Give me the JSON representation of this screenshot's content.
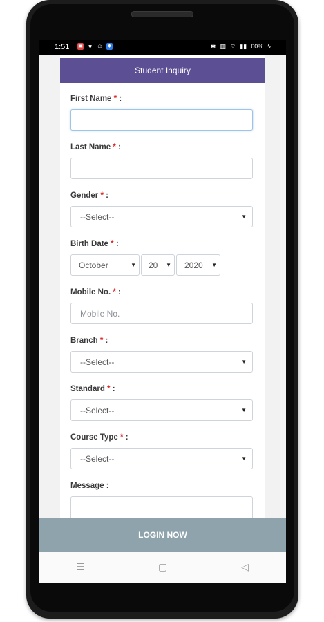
{
  "status_bar": {
    "time": "1:51",
    "battery": "60%"
  },
  "header": {
    "title": "Student Inquiry"
  },
  "form": {
    "first_name": {
      "label": "First Name",
      "required_mark": "*",
      "colon": ":",
      "value": ""
    },
    "last_name": {
      "label": "Last Name",
      "required_mark": "*",
      "colon": ":",
      "value": ""
    },
    "gender": {
      "label": "Gender",
      "required_mark": "*",
      "colon": ":",
      "selected": "--Select--"
    },
    "birth_date": {
      "label": "Birth Date",
      "required_mark": "*",
      "colon": ":",
      "month": "October",
      "day": "20",
      "year": "2020"
    },
    "mobile": {
      "label": "Mobile No.",
      "required_mark": "*",
      "colon": ":",
      "placeholder": "Mobile No."
    },
    "branch": {
      "label": "Branch",
      "required_mark": "*",
      "colon": ":",
      "selected": "--Select--"
    },
    "standard": {
      "label": "Standard",
      "required_mark": "*",
      "colon": ":",
      "selected": "--Select--"
    },
    "course_type": {
      "label": "Course Type",
      "required_mark": "*",
      "colon": ":",
      "selected": "--Select--"
    },
    "message": {
      "label": "Message",
      "colon": ":"
    }
  },
  "submit_button": {
    "label": "LOGIN NOW"
  },
  "nav_bar": {
    "menu_icon": "menu-icon",
    "home_icon": "home-icon",
    "back_icon": "back-icon"
  },
  "colors": {
    "header_bg": "#5c4f94",
    "button_bg": "#8fa3ad",
    "required": "#e02424"
  }
}
